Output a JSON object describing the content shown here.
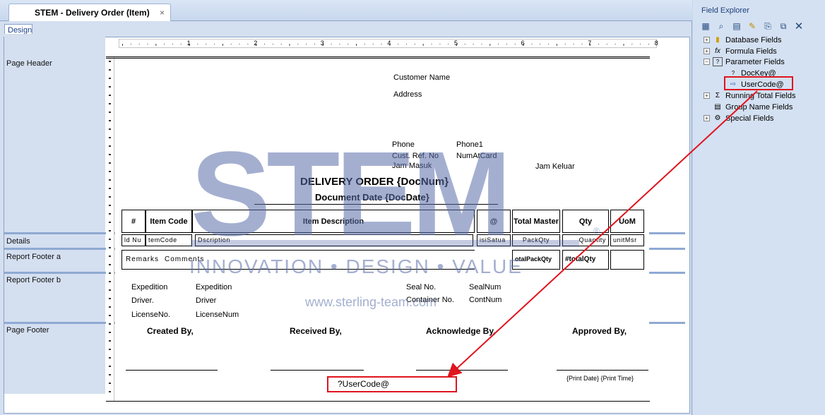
{
  "tab": {
    "title": "STEM - Delivery Order (Item)",
    "close": "×"
  },
  "designer": {
    "mode_tab": "Design"
  },
  "ruler": {
    "numbers": [
      "1",
      "2",
      "3",
      "4",
      "5",
      "6",
      "7",
      "8"
    ]
  },
  "sections": {
    "page_header": "Page Header",
    "details": "Details",
    "report_footer_a": "Report Footer a",
    "report_footer_b": "Report Footer b",
    "page_footer": "Page Footer"
  },
  "header_fields": {
    "customer_name": "Customer Name",
    "address": "Address",
    "phone": "Phone",
    "phone_value": "Phone1",
    "cust_ref": "Cust. Ref. No",
    "cust_ref_value": "NumAtCard",
    "jam_masuk": "Jam Masuk",
    "jam_keluar": "Jam Keluar",
    "title": "DELIVERY ORDER {DocNum}",
    "doc_date": "Document Date {DocDate}"
  },
  "table_headers": [
    "#",
    "Item Code",
    "Item Description",
    "@",
    "Total Master",
    "Qty",
    "UoM"
  ],
  "detail_fields": [
    "ld Nu",
    "temCode",
    "Dscription",
    "isiSatua",
    "PackQty",
    "Quantity",
    "unitMsr"
  ],
  "footer_a": {
    "remarks": "Remarks",
    "comments": "Comments",
    "total_pack": "otalPackQty",
    "total_qty": "#totalQty"
  },
  "footer_b": {
    "expedition": "Expedition",
    "expedition_value": "Expedition",
    "driver": "Driver.",
    "driver_value": "Driver",
    "license": "LicenseNo.",
    "license_value": "LicenseNum",
    "seal": "Seal No.",
    "seal_value": "SealNum",
    "container": "Container No.",
    "container_value": "ContNum"
  },
  "page_footer": {
    "created_by": "Created By,",
    "received_by": "Received By,",
    "acknowledge_by": "Acknowledge By,",
    "approved_by": "Approved By,",
    "print_date": "{Print Date} {Print Time}",
    "user_code": "?UserCode@"
  },
  "watermark": {
    "logo": "STEM",
    "tagline": "INNOVATION • DESIGN • VALUE",
    "url": "www.sterling-team.com",
    "reg": "®"
  },
  "explorer": {
    "title": "Field Explorer",
    "toolbar": [
      "insert-icon",
      "browse-icon",
      "new-icon",
      "edit-icon",
      "rename-icon",
      "copy-icon",
      "delete-icon"
    ],
    "items": [
      {
        "label": "Database Fields",
        "expander": "+"
      },
      {
        "label": "Formula Fields",
        "expander": "+"
      },
      {
        "label": "Parameter Fields",
        "expander": "−"
      },
      {
        "label": "DocKey@",
        "expander": ""
      },
      {
        "label": "UserCode@",
        "expander": ""
      },
      {
        "label": "Running Total Fields",
        "expander": "+"
      },
      {
        "label": "Group Name Fields",
        "expander": ""
      },
      {
        "label": "Special Fields",
        "expander": "+"
      }
    ]
  },
  "colors": {
    "highlight": "#e0141e",
    "panel": "#d4e1f2",
    "accent": "#20407a"
  }
}
